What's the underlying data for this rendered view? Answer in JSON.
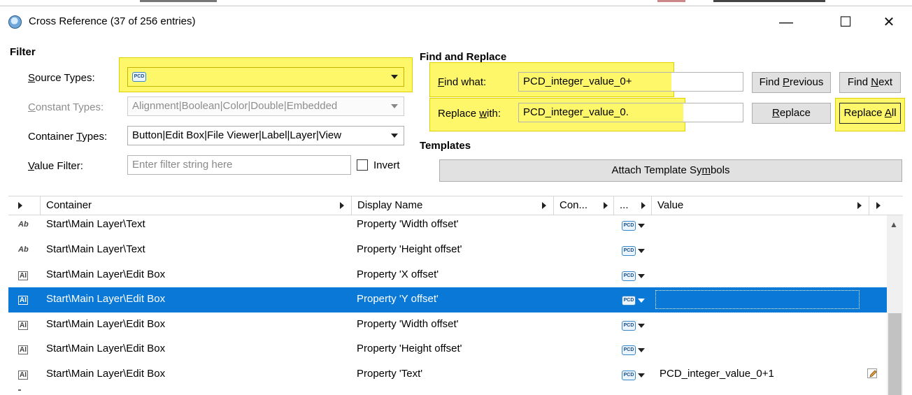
{
  "window": {
    "title": "Cross Reference (37 of 256 entries)",
    "min_glyph": "—",
    "max_glyph": "☐",
    "close_glyph": "✕"
  },
  "filter": {
    "header": "Filter",
    "source_types_label": "Source Types:",
    "source_types_value_icon": "PCD",
    "constant_types_label": "Constant Types:",
    "constant_types_value": "Alignment|Boolean|Color|Double|Embedded",
    "container_types_label": "Container Types:",
    "container_types_value": "Button|Edit Box|File Viewer|Label|Layer|View",
    "value_filter_label": "Value Filter:",
    "value_filter_placeholder": "Enter filter string here",
    "invert_label": "Invert"
  },
  "find_replace": {
    "header": "Find and Replace",
    "find_label": "Find what:",
    "find_value": "PCD_integer_value_0+",
    "replace_label": "Replace with:",
    "replace_value": "PCD_integer_value_0.",
    "find_previous": "Find Previous",
    "find_next": "Find Next",
    "replace": "Replace",
    "replace_all": "Replace All"
  },
  "templates": {
    "header": "Templates",
    "attach_button": "Attach Template Symbols"
  },
  "table": {
    "columns": [
      "Container",
      "Display Name",
      "Con...",
      "...",
      "Value"
    ],
    "rows": [
      {
        "icon": "Ab",
        "container": "Start\\Main Layer\\Text",
        "display": "Property 'Width offset'",
        "type": "PCD",
        "value": ""
      },
      {
        "icon": "Ab",
        "container": "Start\\Main Layer\\Text",
        "display": "Property 'Height offset'",
        "type": "PCD",
        "value": ""
      },
      {
        "icon": "AI",
        "container": "Start\\Main Layer\\Edit Box",
        "display": "Property 'X offset'",
        "type": "PCD",
        "value": ""
      },
      {
        "icon": "AI",
        "container": "Start\\Main Layer\\Edit Box",
        "display": "Property 'Y offset'",
        "type": "PCD",
        "value": "",
        "selected": true
      },
      {
        "icon": "AI",
        "container": "Start\\Main Layer\\Edit Box",
        "display": "Property 'Width offset'",
        "type": "PCD",
        "value": ""
      },
      {
        "icon": "AI",
        "container": "Start\\Main Layer\\Edit Box",
        "display": "Property 'Height offset'",
        "type": "PCD",
        "value": ""
      },
      {
        "icon": "AI",
        "container": "Start\\Main Layer\\Edit Box",
        "display": "Property 'Text'",
        "type": "PCD",
        "value": "PCD_integer_value_0+1"
      }
    ]
  },
  "colors": {
    "highlight": "#fff76a",
    "selection": "#0a78d7"
  }
}
